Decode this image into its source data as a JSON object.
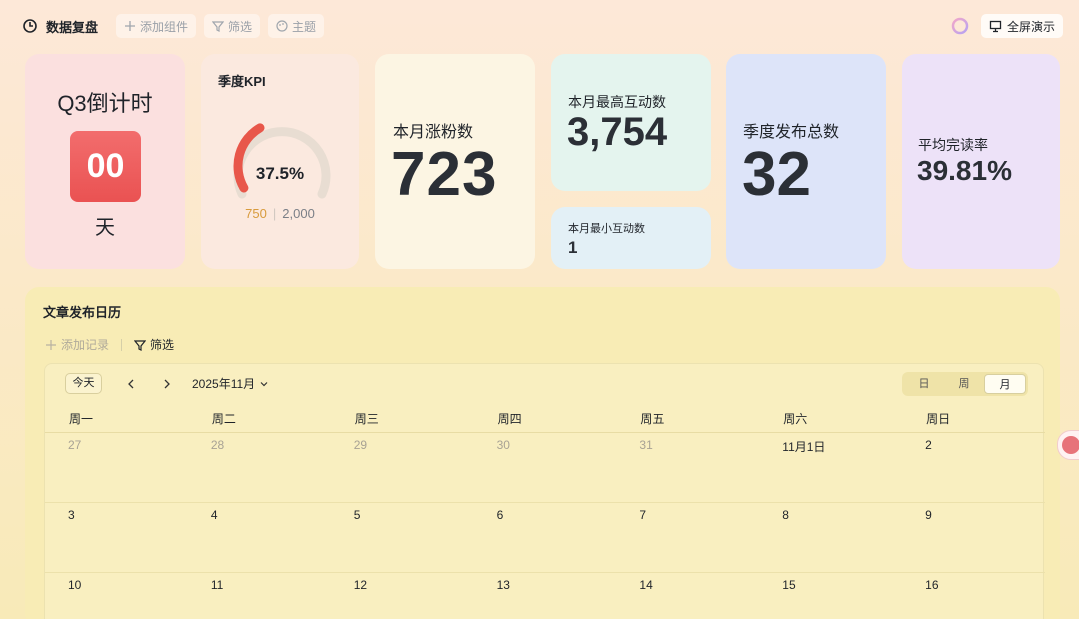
{
  "toolbar": {
    "title": "数据复盘",
    "add_widget": "添加组件",
    "filter": "筛选",
    "theme": "主题",
    "fullscreen": "全屏演示"
  },
  "cards": {
    "countdown": {
      "title": "Q3倒计时",
      "value": "00",
      "unit": "天"
    },
    "kpi": {
      "title": "季度KPI",
      "percent": "37.5%",
      "progress": 0.375,
      "current": "750",
      "target": "2,000"
    },
    "fans": {
      "label": "本月涨粉数",
      "value": "723"
    },
    "max_interaction": {
      "label": "本月最高互动数",
      "value": "3,754"
    },
    "min_interaction": {
      "label": "本月最小互动数",
      "value": "1"
    },
    "publish_total": {
      "label": "季度发布总数",
      "value": "32"
    },
    "read_rate": {
      "label": "平均完读率",
      "value": "39.81%"
    }
  },
  "calendar": {
    "title": "文章发布日历",
    "add_record": "添加记录",
    "filter": "筛选",
    "today": "今天",
    "month": "2025年11月",
    "views": [
      "日",
      "周",
      "月"
    ],
    "active_view": "月",
    "weekdays": [
      "周一",
      "周二",
      "周三",
      "周四",
      "周五",
      "周六",
      "周日"
    ],
    "weeks": [
      [
        {
          "d": "27",
          "other": true
        },
        {
          "d": "28",
          "other": true
        },
        {
          "d": "29",
          "other": true
        },
        {
          "d": "30",
          "other": true
        },
        {
          "d": "31",
          "other": true
        },
        {
          "d": "11月1日",
          "other": false
        },
        {
          "d": "2",
          "other": false
        }
      ],
      [
        {
          "d": "3",
          "other": false
        },
        {
          "d": "4",
          "other": false
        },
        {
          "d": "5",
          "other": false
        },
        {
          "d": "6",
          "other": false
        },
        {
          "d": "7",
          "other": false
        },
        {
          "d": "8",
          "other": false
        },
        {
          "d": "9",
          "other": false
        }
      ],
      [
        {
          "d": "10",
          "other": false
        },
        {
          "d": "11",
          "other": false
        },
        {
          "d": "12",
          "other": false
        },
        {
          "d": "13",
          "other": false
        },
        {
          "d": "14",
          "other": false
        },
        {
          "d": "15",
          "other": false
        },
        {
          "d": "16",
          "other": false
        }
      ]
    ]
  },
  "colors": {
    "countdown_box": "#ea5252",
    "kpi_arc": "#e8574a",
    "kpi_current": "#d89b3c"
  }
}
